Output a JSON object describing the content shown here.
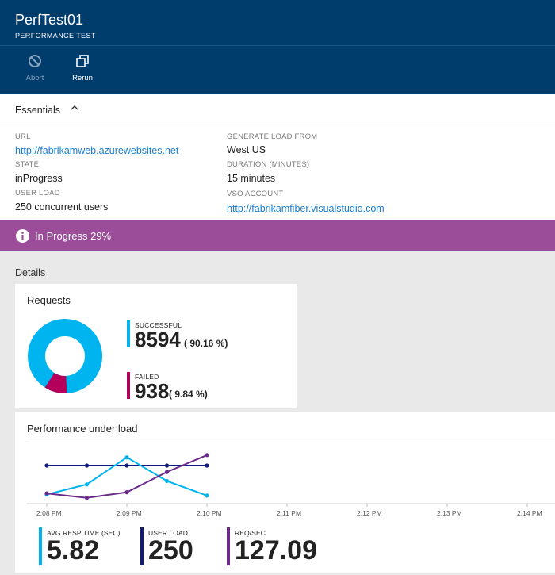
{
  "header": {
    "title": "PerfTest01",
    "subtitle": "PERFORMANCE TEST"
  },
  "commands": {
    "abort": "Abort",
    "rerun": "Rerun"
  },
  "essentials": {
    "title": "Essentials",
    "url_label": "URL",
    "url_value": "http://fabrikamweb.azurewebsites.net",
    "state_label": "STATE",
    "state_value": "inProgress",
    "user_load_label": "USER LOAD",
    "user_load_value": "250 concurrent users",
    "generate_label": "GENERATE LOAD FROM",
    "generate_value": "West US",
    "duration_label": "DURATION (MINUTES)",
    "duration_value": "15 minutes",
    "vso_label": "VSO ACCOUNT",
    "vso_value": "http://fabrikamfiber.visualstudio.com"
  },
  "status": {
    "text": "In Progress 29%",
    "progress": 0.29
  },
  "details": {
    "label": "Details"
  },
  "requests": {
    "title": "Requests",
    "successful_label": "SUCCESSFUL",
    "successful_value": "8594",
    "successful_pct": "( 90.16 %)",
    "failed_label": "FAILED",
    "failed_value": "938",
    "failed_pct": "( 9.84 %)"
  },
  "performance": {
    "title": "Performance under load",
    "metrics": [
      {
        "label": "AVG RESP TIME (SEC)",
        "value": "5.82"
      },
      {
        "label": "USER LOAD",
        "value": "250"
      },
      {
        "label": "REQ/SEC",
        "value": "127.09"
      }
    ]
  },
  "colors": {
    "header_bg": "#003c6c",
    "status_bg": "#9c4d9a",
    "successful": "#00b4f0",
    "failed": "#b4005a",
    "avg_resp": "#00b4f0",
    "user_load": "#0f1c7a",
    "req_sec": "#6b2a8c",
    "link": "#1d7ed0"
  },
  "chart_data": {
    "type": "line",
    "x": [
      "2:08 PM",
      "2:08:30 PM",
      "2:09 PM",
      "2:09:30 PM",
      "2:10 PM",
      "2:10:30 PM"
    ],
    "x_ticks": [
      "2:08 PM",
      "2:09 PM",
      "2:10 PM",
      "2:11 PM",
      "2:12 PM",
      "2:13 PM",
      "2:14 PM"
    ],
    "series": [
      {
        "name": "USER LOAD",
        "values": [
          250,
          250,
          250,
          250,
          250,
          250
        ]
      },
      {
        "name": "AVG RESP TIME (SEC)",
        "values": [
          0.6,
          1.5,
          3.9,
          1.8,
          0.5,
          null
        ]
      },
      {
        "name": "REQ/SEC",
        "values": [
          0.7,
          0.3,
          0.8,
          2.6,
          4.1,
          null
        ]
      }
    ],
    "grid": false
  }
}
